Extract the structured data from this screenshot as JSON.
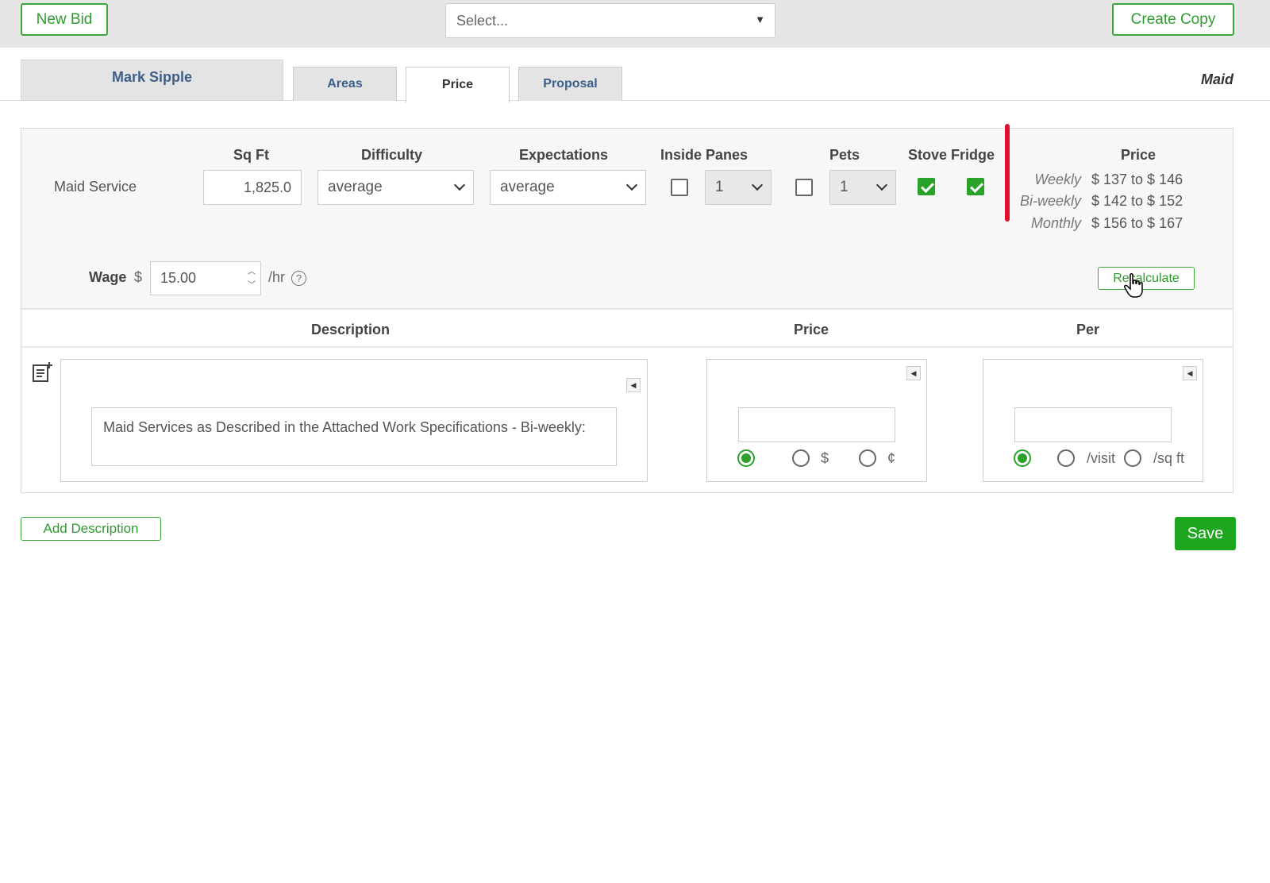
{
  "toolbar": {
    "new_bid_label": "New Bid",
    "select_placeholder": "Select...",
    "create_copy_label": "Create Copy"
  },
  "tabs": {
    "client_name": "Mark Sipple",
    "items": [
      {
        "label": "Areas"
      },
      {
        "label": "Price"
      },
      {
        "label": "Proposal"
      }
    ],
    "active": "Price",
    "service_type": "Maid"
  },
  "pricing": {
    "headers": {
      "sqft": "Sq Ft",
      "difficulty": "Difficulty",
      "expectations": "Expectations",
      "inside_panes": "Inside Panes",
      "pets": "Pets",
      "stove_fridge": "Stove Fridge",
      "price": "Price"
    },
    "row_label": "Maid Service",
    "sqft_value": "1,825.0",
    "difficulty_value": "average",
    "expectations_value": "average",
    "inside_panes_checked": false,
    "inside_panes_count": "1",
    "pets_checked": false,
    "pets_count": "1",
    "stove_checked": true,
    "fridge_checked": true,
    "price_ranges": [
      {
        "label": "Weekly",
        "value": "$ 137 to $ 146"
      },
      {
        "label": "Bi-weekly",
        "value": "$ 142 to $ 152"
      },
      {
        "label": "Monthly",
        "value": "$ 156 to $ 167"
      }
    ],
    "wage_label": "Wage",
    "wage_currency": "$",
    "wage_value": "15.00",
    "wage_unit": "/hr",
    "help_glyph": "?",
    "recalculate_label": "Recalculate"
  },
  "description_grid": {
    "headers": {
      "description": "Description",
      "price": "Price",
      "per": "Per"
    },
    "rows": [
      {
        "description": "Maid Services as Described in the Attached Work Specifications - Bi-weekly:",
        "price_value": "",
        "price_unit_options": [
          "",
          "$",
          "¢"
        ],
        "price_unit_selected": 0,
        "per_value": "",
        "per_options": [
          "",
          "/visit",
          "/sq ft"
        ],
        "per_selected": 0
      }
    ]
  },
  "footer": {
    "add_description_label": "Add Description",
    "save_label": "Save"
  },
  "colors": {
    "accent_green": "#2e9b2e",
    "save_green": "#1ea71e",
    "marker_red": "#e0102c",
    "tab_blue": "#3b5f8a"
  }
}
